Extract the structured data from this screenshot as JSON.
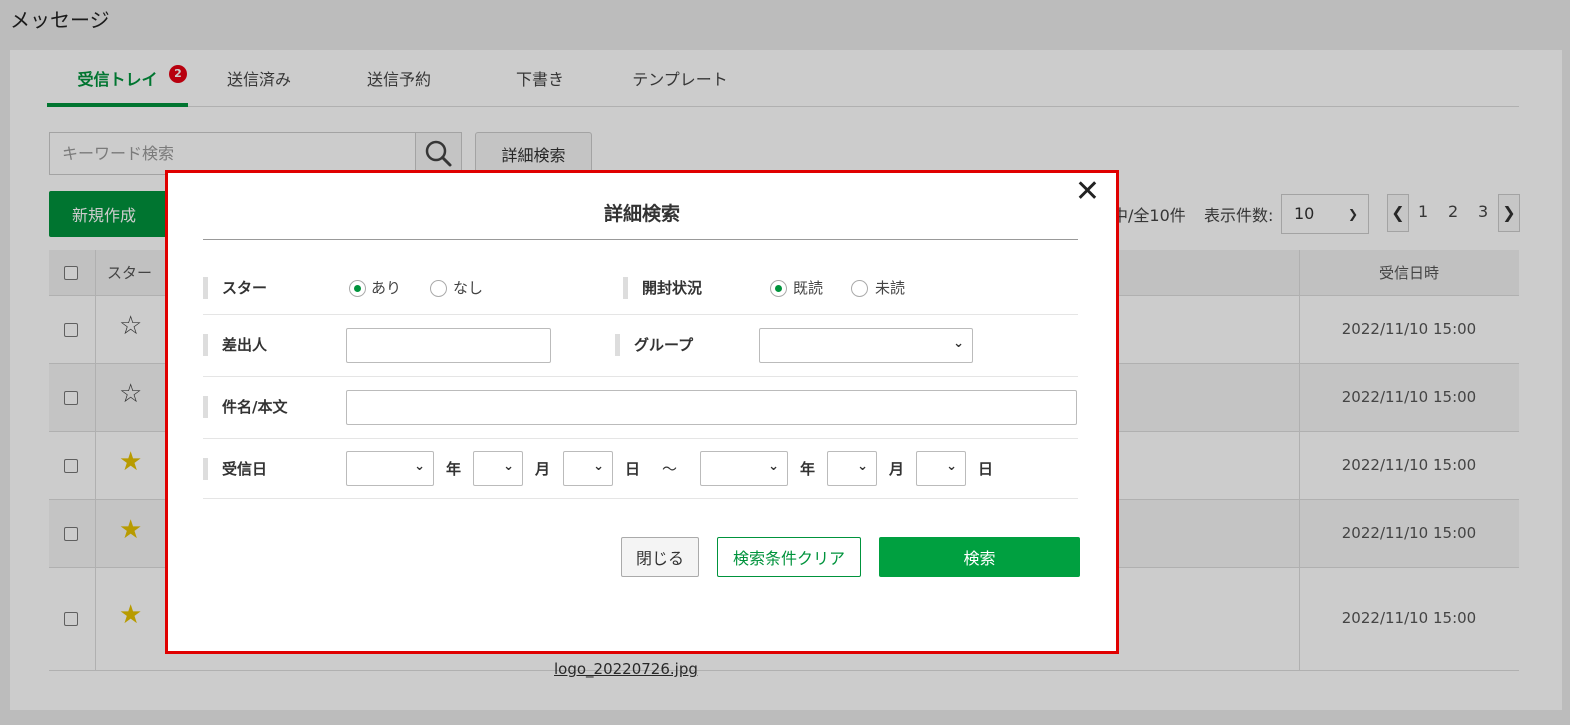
{
  "page": {
    "title": "メッセージ"
  },
  "tabs": [
    {
      "label": "受信トレイ",
      "badge": "2",
      "active": true
    },
    {
      "label": "送信済み"
    },
    {
      "label": "送信予約"
    },
    {
      "label": "下書き"
    },
    {
      "label": "テンプレート"
    }
  ],
  "search": {
    "placeholder": "キーワード検索",
    "advanced_label": "詳細検索"
  },
  "toolbar": {
    "new_label": "新規作成",
    "count_text": "中/全10件",
    "per_page_label": "表示件数:",
    "per_page_value": "10",
    "pages": [
      "1",
      "2",
      "3"
    ]
  },
  "table": {
    "headers": {
      "star": "スター",
      "date": "受信日時"
    },
    "rows": [
      {
        "starred": false,
        "date": "2022/11/10 15:00"
      },
      {
        "starred": false,
        "date": "2022/11/10 15:00"
      },
      {
        "starred": true,
        "date": "2022/11/10 15:00"
      },
      {
        "starred": true,
        "date": "2022/11/10 15:00"
      },
      {
        "starred": true,
        "date": "2022/11/10 15:00",
        "attachment": "logo_20220726.jpg"
      }
    ]
  },
  "modal": {
    "title": "詳細検索",
    "star": {
      "label": "スター",
      "options": [
        "あり",
        "なし"
      ],
      "selected": "あり"
    },
    "opened": {
      "label": "開封状況",
      "options": [
        "既読",
        "未読"
      ],
      "selected": "既読"
    },
    "sender": {
      "label": "差出人",
      "value": ""
    },
    "group": {
      "label": "グループ",
      "value": ""
    },
    "subject": {
      "label": "件名/本文",
      "value": ""
    },
    "received": {
      "label": "受信日",
      "year": "年",
      "month": "月",
      "day": "日",
      "tilde": "～"
    },
    "buttons": {
      "close": "閉じる",
      "clear": "検索条件クリア",
      "search": "検索"
    }
  },
  "colors": {
    "accent": "#00933c",
    "badge": "#e60012",
    "modal_border": "#e00000",
    "star_on": "#e6c200"
  }
}
